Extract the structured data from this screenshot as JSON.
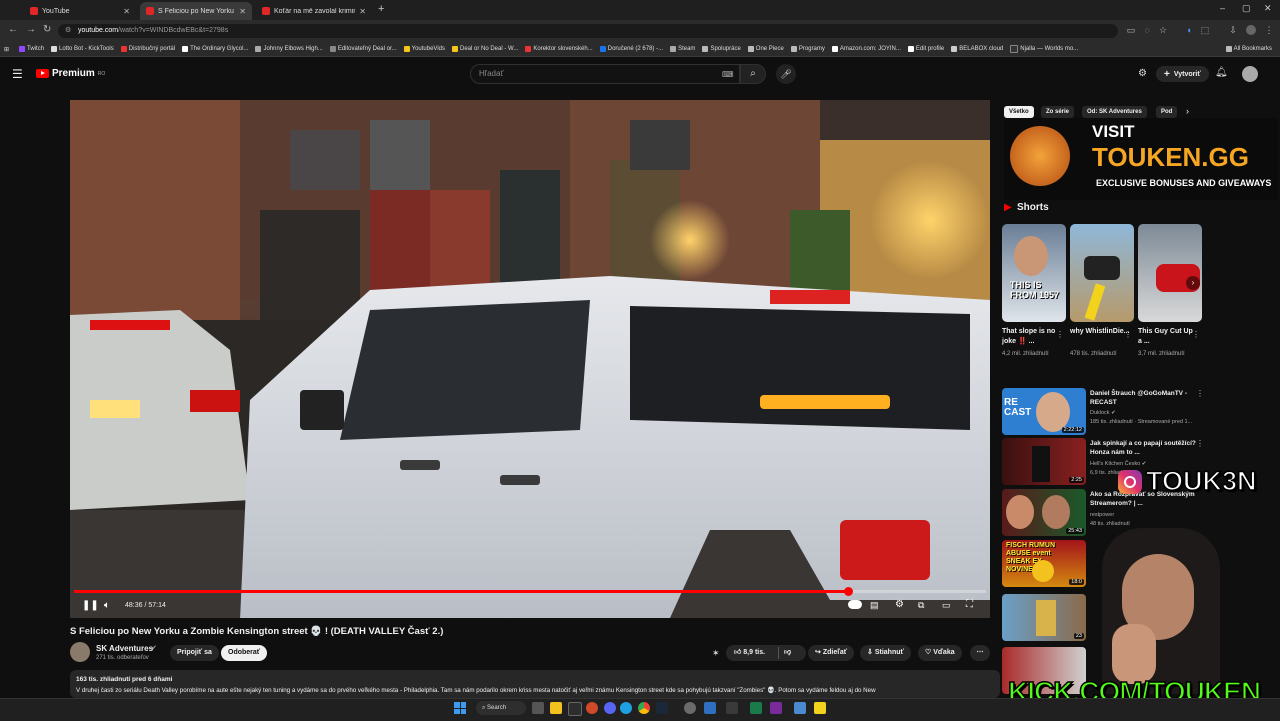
{
  "browser": {
    "tabs": [
      {
        "title": "YouTube",
        "active": false
      },
      {
        "title": "S Feliciou po New Yorku a Zomb",
        "active": true
      },
      {
        "title": "Koťár na mě zavolal kriminálku",
        "active": false
      }
    ],
    "url_host": "youtube.com",
    "url_path": "/watch?v=WINDBcdwEBc&t=2798s",
    "bookmarks": [
      "Twitch",
      "Lotto Bot - KickTools",
      "Distribučný portál",
      "The Ordinary Glycol...",
      "Johnny Elbows High...",
      "Editovateľný Deal or...",
      "YoutubeVids",
      "Deal or No Deal - W...",
      "Korektor slovenskéh...",
      "Doručené (2 678) -...",
      "Steam",
      "Spolupráce",
      "One Piece",
      "Programy",
      "Amazon.com: JOYIN...",
      "Edit profile",
      "BELABOX cloud",
      "Njalla — Worlds mo..."
    ],
    "all_bookmarks": "All Bookmarks"
  },
  "youtube": {
    "logo": "Premium",
    "logo_region": "RO",
    "search_placeholder": "Hľadať",
    "create_label": "Vytvoriť"
  },
  "player": {
    "time": "48:36 / 57:14",
    "progress": 0.849
  },
  "video": {
    "title": "S Feliciou po New Yorku a Zombie Kensington street 💀 ! (DEATH VALLEY Časť 2.)",
    "channel": "SK Adventures",
    "subscribers": "271 tis. odberateľov",
    "join_label": "Pripojiť sa",
    "unsubscribe_label": "Odoberať",
    "likes": "8,9 tis.",
    "share_label": "Zdieľať",
    "download_label": "Stiahnuť",
    "thanks_label": "Vďaka",
    "stats": "163 tis. zhliadnutí  pred 6 dňami",
    "description": "V druhej časti zo seriálu Death Valley porobíme na aute ešte nejaký ten tuning a vydáme sa do prvého veľkého mesta - Philadelphia. Tam sa nám podarilo okrem kriss mesta natočiť aj veľmi známu Kensington street kde sa pohybujú takzvaní \"Zombies\" 💀. Potom sa vydáme feldou aj do New"
  },
  "sidebar": {
    "chips": [
      "Všetko",
      "Zo série",
      "Od: SK Adventures",
      "Pod"
    ],
    "ad": {
      "line1": "VISIT",
      "line2": "TOUKEN.GG",
      "line3": "EXCLUSIVE BONUSES AND GIVEAWAYS"
    },
    "shorts_heading": "Shorts",
    "shorts": [
      {
        "title": "That slope is no joke ‼️ ...",
        "views": "4,2 mil. zhliadnutí",
        "overlay": "THIS IS FROM 1957"
      },
      {
        "title": "why WhistlinDie...",
        "views": "478 tis. zhliadnutí",
        "overlay": ""
      },
      {
        "title": "This Guy Cut Up a ...",
        "views": "3,7 mil. zhliadnutí",
        "overlay": ""
      }
    ],
    "recommended": [
      {
        "title": "Daniel Štrauch @GoGoManTV - RECAST",
        "channel": "Duklock ✔",
        "meta": "185 tis. zhliadnutí · Streamované pred 1...",
        "duration": "2:22:12",
        "thumb_text": "RE CAST"
      },
      {
        "title": "Jak spinkají a co papají soutěžící? Honza nám to ...",
        "channel": "Hell's Kitchen Česko ✔",
        "meta": "6,9 tis. zhliadnutí",
        "duration": "2:25",
        "thumb_text": ""
      },
      {
        "title": "Ako sa Rozprávať so Slovenským Streamerom? | ...",
        "channel": "restpower",
        "meta": "48 tis. zhliadnutí",
        "duration": "25:43",
        "thumb_text": ""
      },
      {
        "title": "",
        "channel": "",
        "meta": "",
        "duration": "18:0",
        "thumb_text": "FISCH RUMUN ABUSE event SNEAK EX NOVINEK"
      },
      {
        "title": "",
        "channel": "",
        "meta": "",
        "duration": "23",
        "thumb_text": ""
      },
      {
        "title": "",
        "channel": "",
        "meta": "",
        "duration": "",
        "thumb_text": ""
      }
    ]
  },
  "overlays": {
    "instagram": "TOUK3N",
    "kick": "KICK.COM/TOUKEN"
  },
  "taskbar": {
    "search_label": "Search"
  }
}
